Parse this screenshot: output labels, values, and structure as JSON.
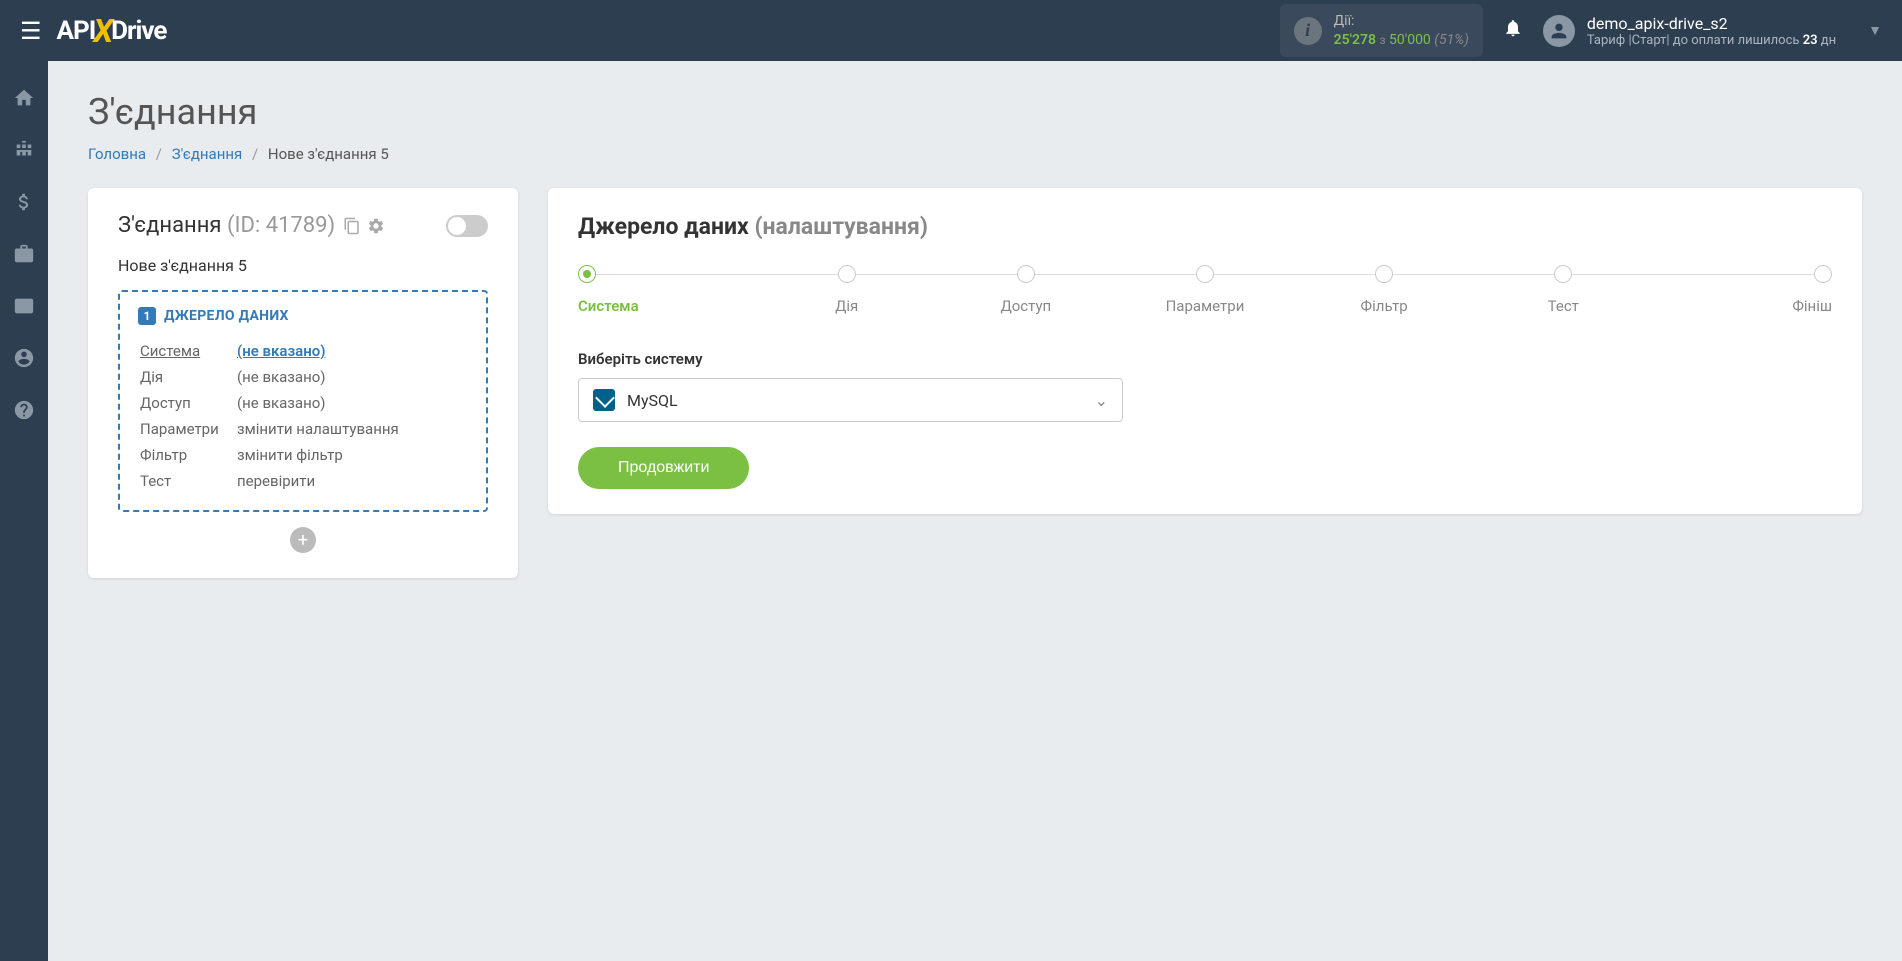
{
  "header": {
    "actions_label": "Дії:",
    "actions_used": "25'278",
    "actions_sep": "з",
    "actions_total": "50'000",
    "actions_pct": "(51%)",
    "user_name": "demo_apix-drive_s2",
    "tariff_prefix": "Тариф |Старт| до оплати лишилось",
    "tariff_days": "23",
    "tariff_suffix": "дн"
  },
  "page": {
    "title": "З'єднання",
    "breadcrumb_home": "Головна",
    "breadcrumb_conn": "З'єднання",
    "breadcrumb_current": "Нове з'єднання 5"
  },
  "left": {
    "title": "З'єднання",
    "id_label": "(ID: 41789)",
    "conn_name": "Нове з'єднання 5",
    "source_badge": "1",
    "source_title": "ДЖЕРЕЛО ДАНИХ",
    "rows": {
      "system_label": "Система",
      "system_value": "(не вказано)",
      "action_label": "Дія",
      "action_value": "(не вказано)",
      "access_label": "Доступ",
      "access_value": "(не вказано)",
      "params_label": "Параметри",
      "params_value": "змінити налаштування",
      "filter_label": "Фільтр",
      "filter_value": "змінити фільтр",
      "test_label": "Тест",
      "test_value": "перевірити"
    }
  },
  "right": {
    "title": "Джерело даних",
    "subtitle": "(налаштування)",
    "steps": {
      "system": "Система",
      "action": "Дія",
      "access": "Доступ",
      "params": "Параметри",
      "filter": "Фільтр",
      "test": "Тест",
      "finish": "Фініш"
    },
    "field_label": "Виберіть систему",
    "selected_system": "MySQL",
    "continue": "Продовжити"
  }
}
